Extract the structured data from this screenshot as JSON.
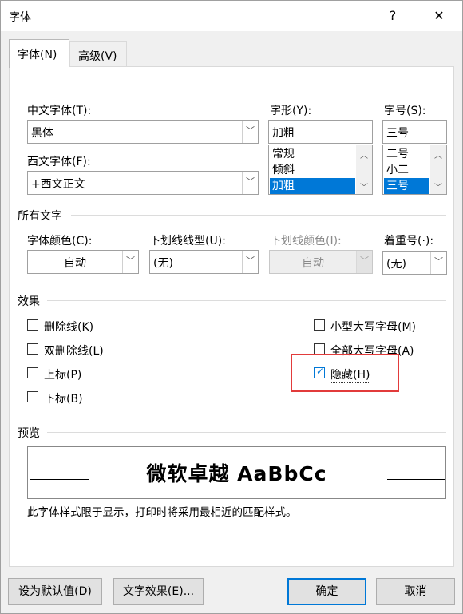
{
  "window": {
    "title": "字体",
    "help": "?",
    "close": "✕"
  },
  "tabs": [
    {
      "label": "字体(N)",
      "active": true
    },
    {
      "label": "高级(V)",
      "active": false
    }
  ],
  "font": {
    "chinese_label": "中文字体(T):",
    "chinese_value": "黑体",
    "western_label": "西文字体(F):",
    "western_value": "+西文正文",
    "style_label": "字形(Y):",
    "style_value": "加粗",
    "style_options": [
      "常规",
      "倾斜",
      "加粗"
    ],
    "style_selected": 2,
    "size_label": "字号(S):",
    "size_value": "三号",
    "size_options": [
      "二号",
      "小二",
      "三号"
    ],
    "size_selected": 2
  },
  "all_text": {
    "section": "所有文字",
    "color_label": "字体颜色(C):",
    "color_value": "自动",
    "underline_label": "下划线线型(U):",
    "underline_value": "(无)",
    "underline_color_label": "下划线颜色(I):",
    "underline_color_value": "自动",
    "emphasis_label": "着重号(·):",
    "emphasis_value": "(无)"
  },
  "effects": {
    "section": "效果",
    "items": [
      {
        "label": "删除线(K)",
        "checked": false
      },
      {
        "label": "双删除线(L)",
        "checked": false
      },
      {
        "label": "上标(P)",
        "checked": false
      },
      {
        "label": "下标(B)",
        "checked": false
      },
      {
        "label": "小型大写字母(M)",
        "checked": false
      },
      {
        "label": "全部大写字母(A)",
        "checked": false
      },
      {
        "label": "隐藏(H)",
        "checked": true
      }
    ]
  },
  "preview": {
    "section": "预览",
    "sample": "微软卓越  AaBbCc",
    "note": "此字体样式限于显示，打印时将采用最相近的匹配样式。"
  },
  "buttons": {
    "set_default": "设为默认值(D)",
    "text_effects": "文字效果(E)...",
    "ok": "确定",
    "cancel": "取消"
  },
  "colors": {
    "accent": "#0078d7",
    "highlight_box": "#e23b3b"
  }
}
